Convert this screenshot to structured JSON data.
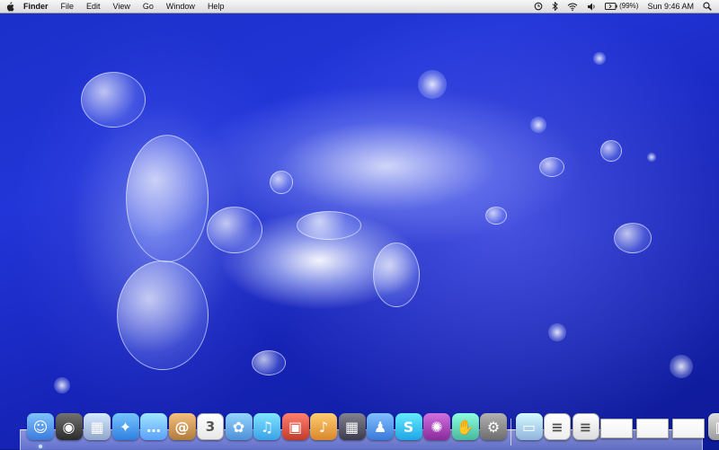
{
  "menubar": {
    "apple_icon": "apple-logo-icon",
    "app_name": "Finder",
    "menus": [
      "File",
      "Edit",
      "View",
      "Go",
      "Window",
      "Help"
    ],
    "status": {
      "time_machine_icon": "time-machine-icon",
      "bluetooth_icon": "bluetooth-icon",
      "wifi_icon": "wifi-icon",
      "volume_icon": "volume-icon",
      "battery_icon": "battery-icon",
      "battery_text": "(99%)",
      "clock": "Sun 9:46 AM",
      "spotlight_icon": "spotlight-search-icon"
    }
  },
  "dock": {
    "apps": [
      {
        "name": "finder",
        "icon": "finder-icon",
        "glyph": "☺",
        "color": "#3a7bdc"
      },
      {
        "name": "dashboard",
        "icon": "dashboard-icon",
        "glyph": "◉",
        "color": "#2b2b2b"
      },
      {
        "name": "preview",
        "icon": "preview-icon",
        "glyph": "▦",
        "color": "#8fa4c9"
      },
      {
        "name": "safari",
        "icon": "safari-icon",
        "glyph": "✦",
        "color": "#2f7fe0"
      },
      {
        "name": "ichat",
        "icon": "ichat-icon",
        "glyph": "…",
        "color": "#5aa0ff"
      },
      {
        "name": "address-book",
        "icon": "address-book-icon",
        "glyph": "@",
        "color": "#b07a3a"
      },
      {
        "name": "ical",
        "icon": "ical-icon",
        "glyph": "3",
        "color": "#e8e8e8"
      },
      {
        "name": "iphoto",
        "icon": "iphoto-icon",
        "glyph": "✿",
        "color": "#4e8fd8"
      },
      {
        "name": "itunes",
        "icon": "itunes-icon",
        "glyph": "♫",
        "color": "#3aa0e8"
      },
      {
        "name": "photo-booth",
        "icon": "photo-booth-icon",
        "glyph": "▣",
        "color": "#c23a2a"
      },
      {
        "name": "garageband",
        "icon": "garageband-icon",
        "glyph": "♪",
        "color": "#d8872a"
      },
      {
        "name": "spaces",
        "icon": "spaces-icon",
        "glyph": "▦",
        "color": "#3b3b4b"
      },
      {
        "name": "msn-messenger",
        "icon": "messenger-icon",
        "glyph": "♟",
        "color": "#3a79d9"
      },
      {
        "name": "skype",
        "icon": "skype-icon",
        "glyph": "S",
        "color": "#1fa5e6"
      },
      {
        "name": "chat-app",
        "icon": "chat-bubble-icon",
        "glyph": "✺",
        "color": "#8a2a9a"
      },
      {
        "name": "growl",
        "icon": "hand-icon",
        "glyph": "✋",
        "color": "#48b89b"
      },
      {
        "name": "system-preferences",
        "icon": "system-preferences-icon",
        "glyph": "⚙",
        "color": "#6c6c6c"
      }
    ],
    "docs": [
      {
        "name": "applications-folder",
        "icon": "folder-icon",
        "glyph": "▭",
        "color": "#8fb4dc"
      },
      {
        "name": "document",
        "icon": "document-icon",
        "glyph": "≡",
        "color": "#eeeeee"
      },
      {
        "name": "file-stack",
        "icon": "stack-icon",
        "glyph": "≡",
        "color": "#dcdcdc"
      },
      {
        "name": "minimized-window-1",
        "icon": "window-thumbnail-icon",
        "glyph": "",
        "color": "#f2f2f2"
      },
      {
        "name": "minimized-window-2",
        "icon": "window-thumbnail-icon",
        "glyph": "",
        "color": "#f2f2f2"
      },
      {
        "name": "minimized-window-3",
        "icon": "window-thumbnail-icon",
        "glyph": "",
        "color": "#f2f2f2"
      },
      {
        "name": "trash",
        "icon": "trash-icon",
        "glyph": "▥",
        "color": "#9a9a9a"
      }
    ]
  },
  "desktop": {
    "wallpaper": "blue water splash",
    "accent": "#1f30c8"
  }
}
